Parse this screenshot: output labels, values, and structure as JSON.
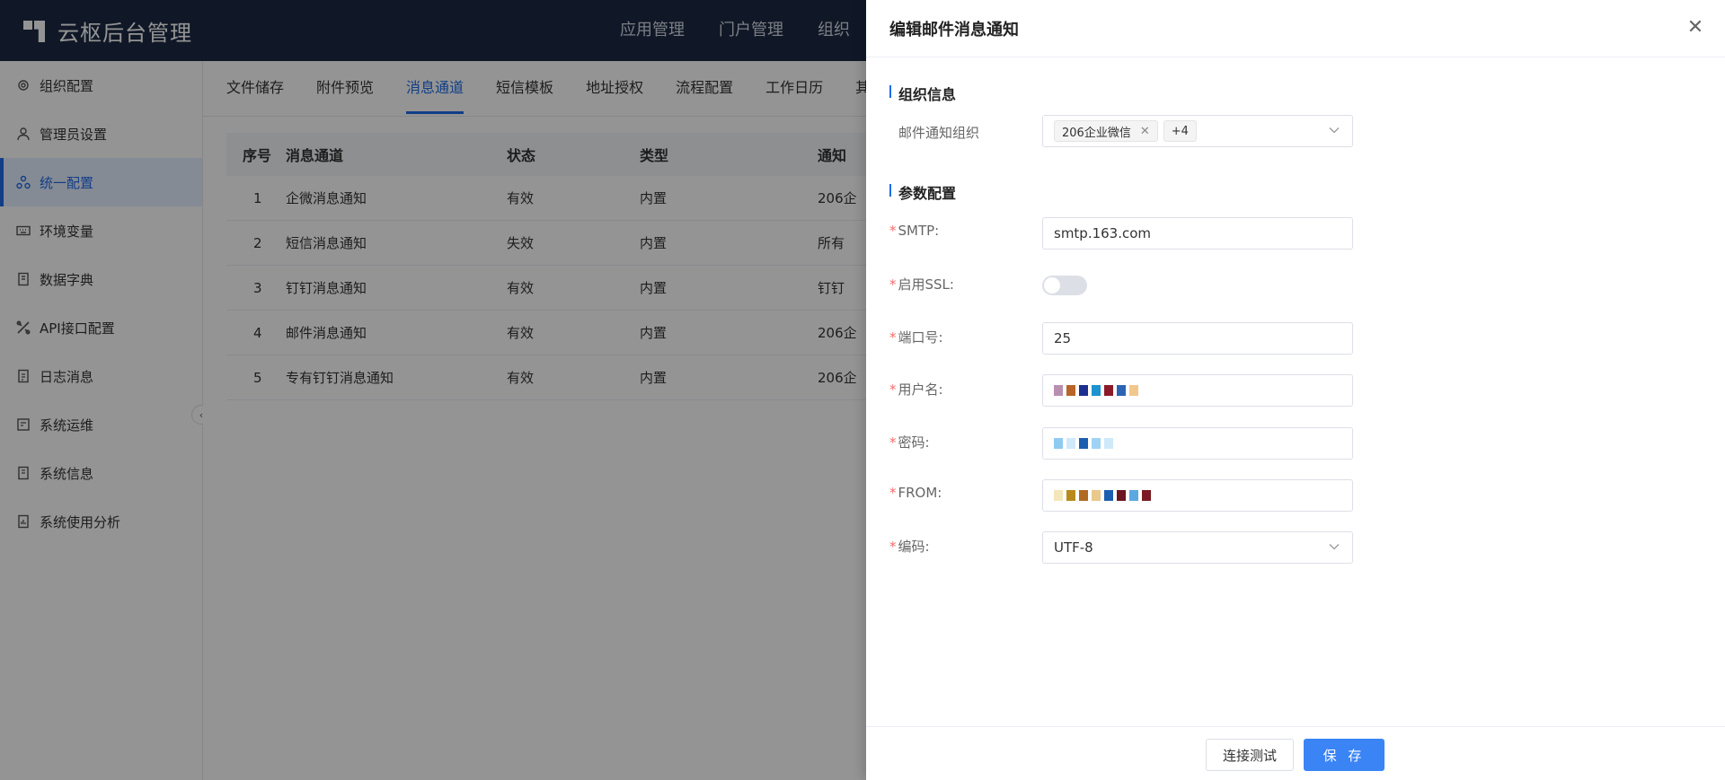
{
  "header": {
    "title": "云枢后台管理",
    "nav": [
      "应用管理",
      "门户管理",
      "组织"
    ]
  },
  "sidebar": {
    "items": [
      {
        "label": "组织配置",
        "icon": "gear-icon"
      },
      {
        "label": "管理员设置",
        "icon": "user-icon"
      },
      {
        "label": "统一配置",
        "icon": "cluster-icon"
      },
      {
        "label": "环境变量",
        "icon": "keyboard-icon"
      },
      {
        "label": "数据字典",
        "icon": "book-icon"
      },
      {
        "label": "API接口配置",
        "icon": "api-icon"
      },
      {
        "label": "日志消息",
        "icon": "log-icon"
      },
      {
        "label": "系统运维",
        "icon": "monitor-icon"
      },
      {
        "label": "系统信息",
        "icon": "info-icon"
      },
      {
        "label": "系统使用分析",
        "icon": "analytics-icon"
      }
    ],
    "active_index": 2
  },
  "tabs": [
    "文件储存",
    "附件预览",
    "消息通道",
    "短信模板",
    "地址授权",
    "流程配置",
    "工作日历",
    "其"
  ],
  "active_tab": "消息通道",
  "table": {
    "columns": [
      "序号",
      "消息通道",
      "状态",
      "类型",
      "通知"
    ],
    "rows": [
      {
        "no": "1",
        "name": "企微消息通知",
        "status": "有效",
        "type": "内置",
        "notify": "206企"
      },
      {
        "no": "2",
        "name": "短信消息通知",
        "status": "失效",
        "type": "内置",
        "notify": "所有"
      },
      {
        "no": "3",
        "name": "钉钉消息通知",
        "status": "有效",
        "type": "内置",
        "notify": "钉钉"
      },
      {
        "no": "4",
        "name": "邮件消息通知",
        "status": "有效",
        "type": "内置",
        "notify": "206企"
      },
      {
        "no": "5",
        "name": "专有钉钉消息通知",
        "status": "有效",
        "type": "内置",
        "notify": "206企"
      }
    ]
  },
  "drawer": {
    "title": "编辑邮件消息通知",
    "section_org": "组织信息",
    "org_label": "邮件通知组织",
    "org_chip": "206企业微信",
    "org_more": "+4",
    "section_params": "参数配置",
    "smtp_label": "SMTP:",
    "smtp_value": "smtp.163.com",
    "ssl_label": "启用SSL:",
    "ssl_enabled": false,
    "port_label": "端口号:",
    "port_value": "25",
    "username_label": "用户名:",
    "password_label": "密码:",
    "from_label": "FROM:",
    "encoding_label": "编码:",
    "encoding_value": "UTF-8",
    "test_button": "连接测试",
    "save_button": "保 存"
  }
}
